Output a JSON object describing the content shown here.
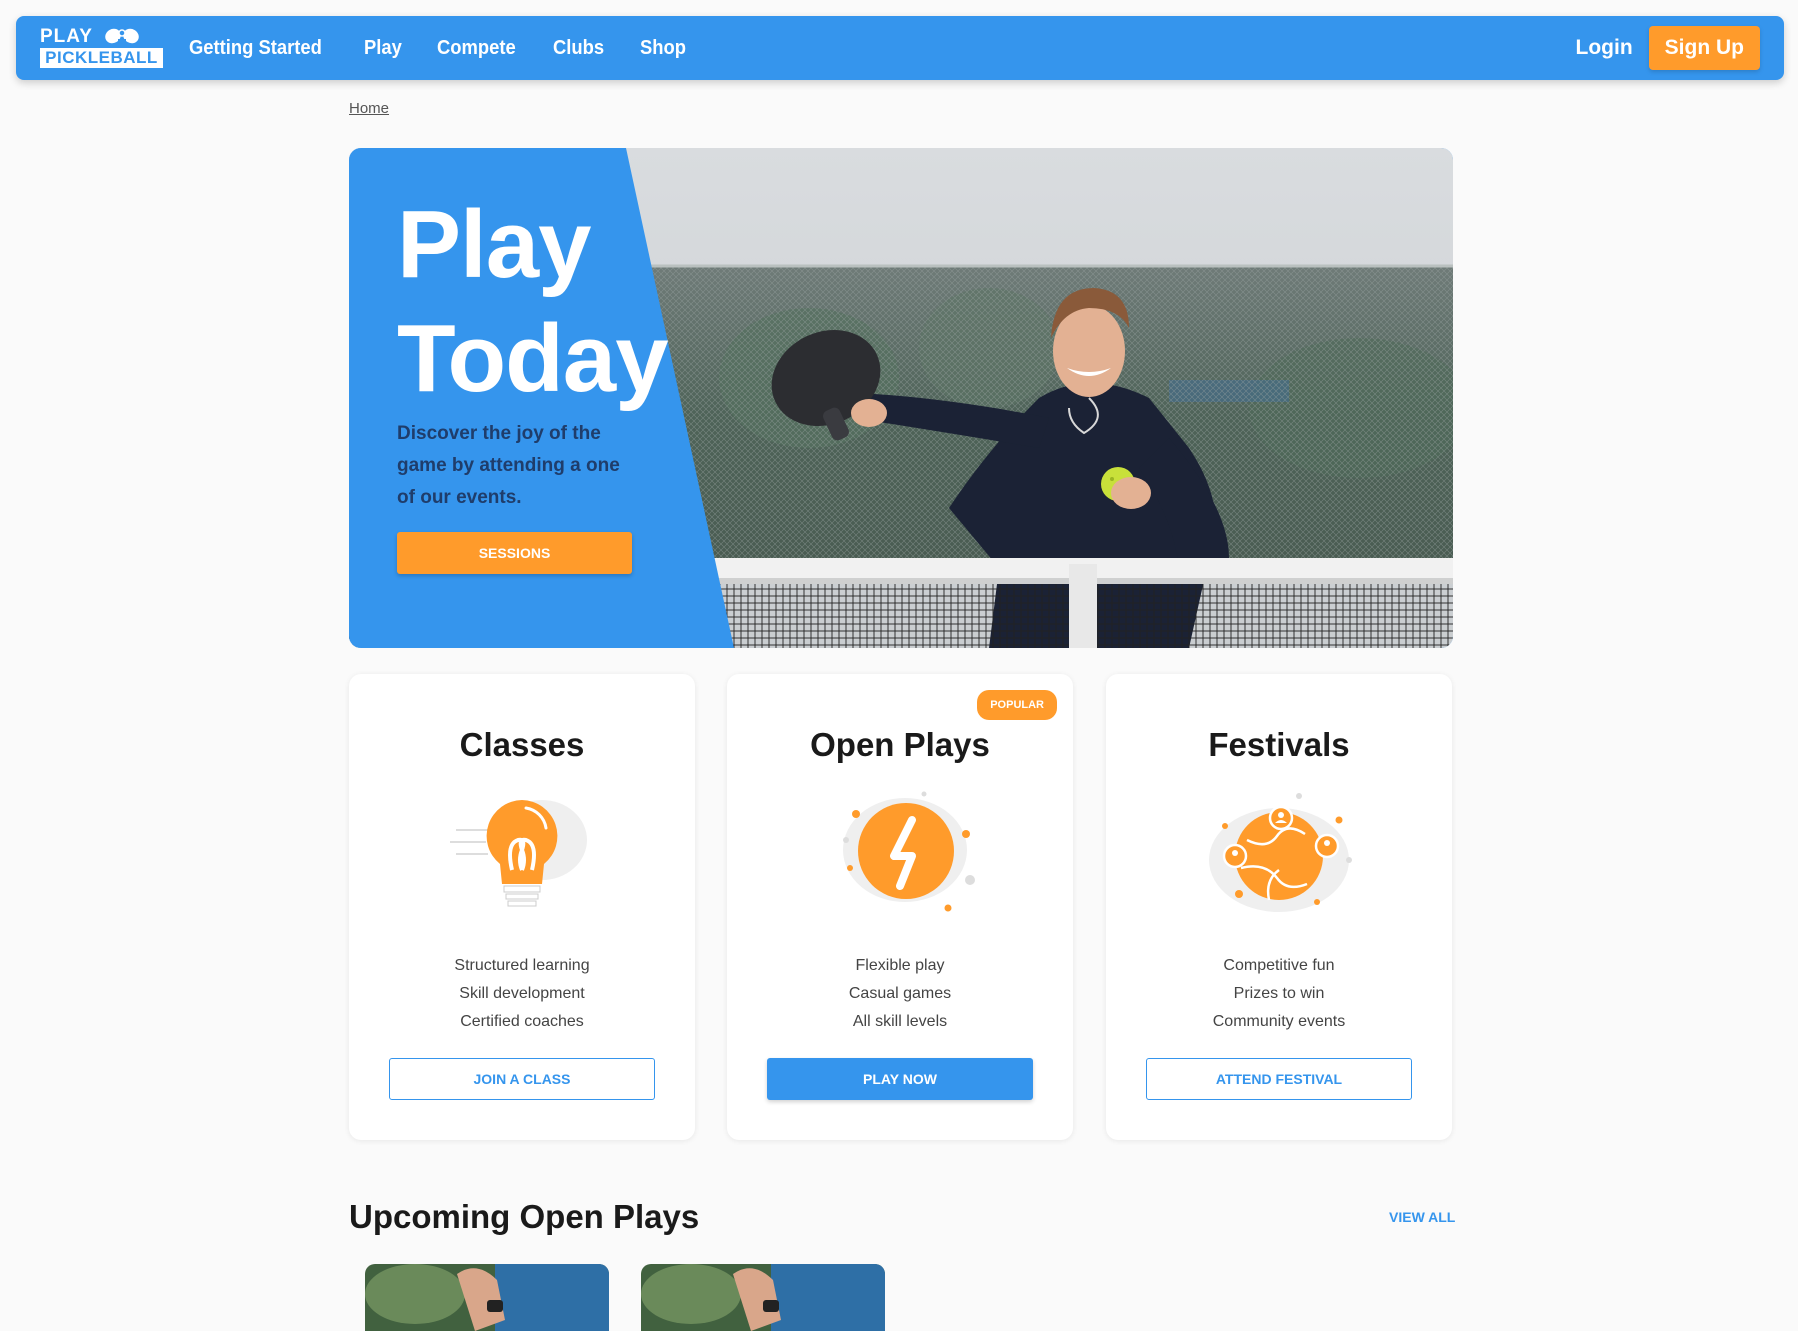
{
  "brand": {
    "line1": "PLAY",
    "line2": "PICKLEBALL",
    "colors": {
      "primary": "#3595ed",
      "accent": "#ff9b2b"
    }
  },
  "nav": {
    "links": [
      "Getting Started",
      "Play",
      "Compete",
      "Clubs",
      "Shop"
    ],
    "login": "Login",
    "signup": "Sign Up"
  },
  "breadcrumb": {
    "home": "Home"
  },
  "hero": {
    "title_line1": "Play",
    "title_line2": "Today",
    "subtitle": "Discover the joy of the game by attending a one of our events.",
    "button": "SESSIONS",
    "image": "player-with-paddle-photo"
  },
  "cards": [
    {
      "title": "Classes",
      "icon": "lightbulb-icon",
      "lines": [
        "Structured learning",
        "Skill development",
        "Certified coaches"
      ],
      "button": "JOIN A CLASS",
      "badge": ""
    },
    {
      "title": "Open Plays",
      "icon": "lightning-icon",
      "lines": [
        "Flexible play",
        "Casual games",
        "All skill levels"
      ],
      "button": "PLAY NOW",
      "badge": "POPULAR"
    },
    {
      "title": "Festivals",
      "icon": "globe-community-icon",
      "lines": [
        "Competitive fun",
        "Prizes to win",
        "Community events"
      ],
      "button": "ATTEND FESTIVAL",
      "badge": ""
    }
  ],
  "upcoming": {
    "title": "Upcoming Open Plays",
    "view_all": "VIEW ALL",
    "events": [
      "open-play-photo-1",
      "open-play-photo-2"
    ]
  }
}
